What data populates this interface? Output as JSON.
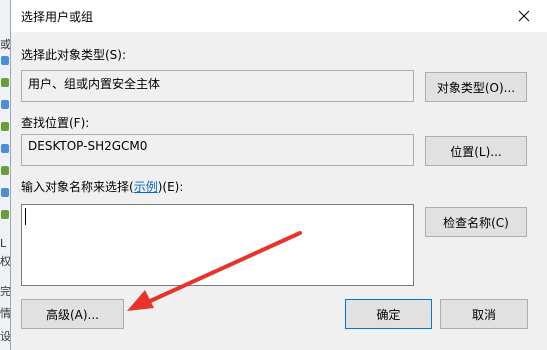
{
  "background": {
    "glyphs": [
      "或",
      "L",
      "权",
      "完",
      "情",
      "设"
    ]
  },
  "dialog": {
    "title": "选择用户或组",
    "object_type": {
      "label": "选择此对象类型(S):",
      "value": "用户、组或内置安全主体",
      "button": "对象类型(O)..."
    },
    "location": {
      "label": "查找位置(F):",
      "value": "DESKTOP-SH2GCM0",
      "button": "位置(L)..."
    },
    "names": {
      "label_prefix": "输入对象名称来选择(",
      "label_link": "示例",
      "label_suffix": ")(E):",
      "value": "",
      "check_button": "检查名称(C)"
    },
    "buttons": {
      "advanced": "高级(A)...",
      "ok": "确定",
      "cancel": "取消"
    }
  },
  "colors": {
    "annotation_arrow": "#e8332a",
    "focus_border": "#0078d7",
    "link": "#0066cc"
  },
  "icons": {
    "close": "close-icon",
    "arrow": "red-arrow-annotation"
  }
}
